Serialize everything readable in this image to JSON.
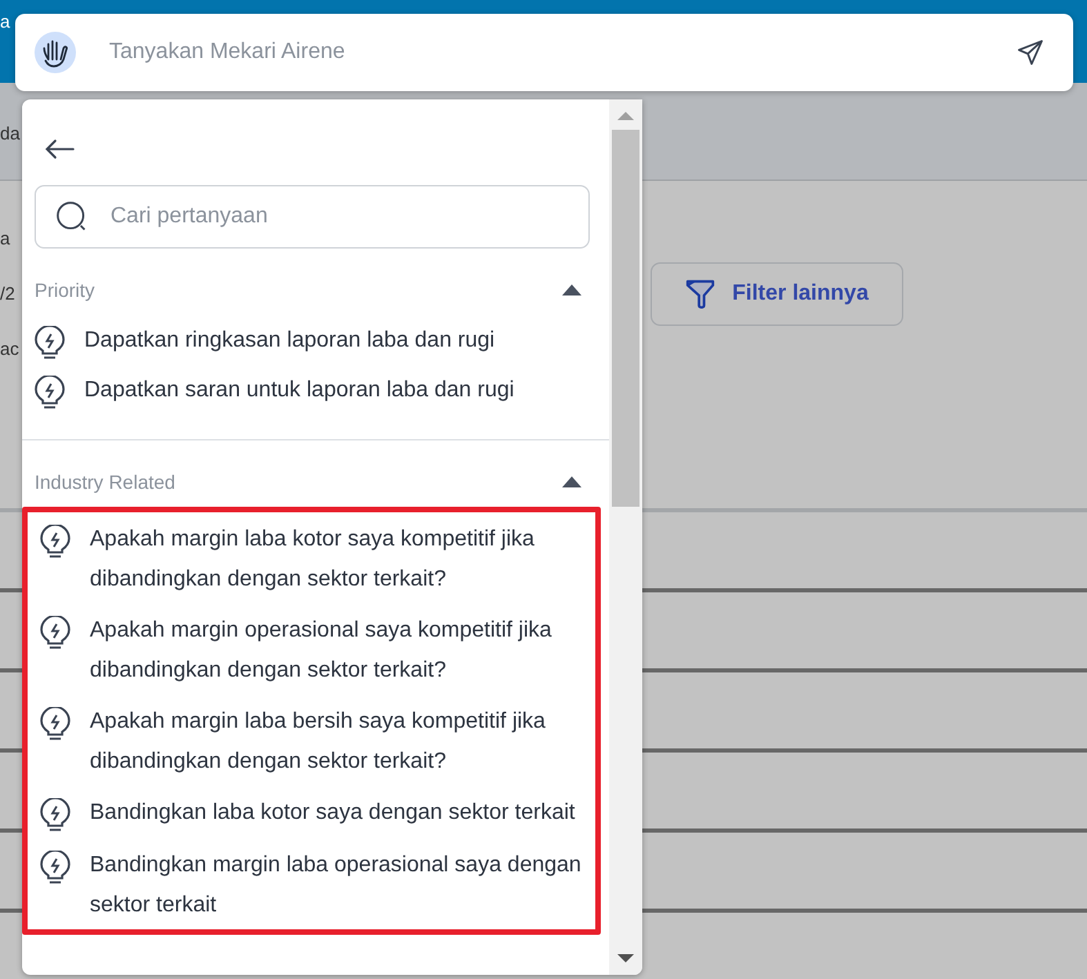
{
  "background": {
    "top_fragment": "a",
    "header_fragment": "da",
    "content_fragments": [
      "a",
      "/2",
      "ac"
    ],
    "filter_button": {
      "label": "Filter lainnya"
    }
  },
  "ask_bar": {
    "placeholder": "Tanyakan Mekari Airene"
  },
  "panel": {
    "search": {
      "placeholder": "Cari pertanyaan"
    },
    "sections": [
      {
        "title": "Priority",
        "expanded": true,
        "highlighted": false,
        "items": [
          "Dapatkan ringkasan laporan laba dan rugi",
          "Dapatkan saran untuk laporan laba dan rugi"
        ]
      },
      {
        "title": "Industry Related",
        "expanded": true,
        "highlighted": true,
        "items": [
          "Apakah margin laba kotor saya kompetitif jika dibandingkan dengan sektor terkait?",
          "Apakah margin operasional saya kompetitif jika dibandingkan dengan sektor terkait?",
          "Apakah margin laba bersih saya kompetitif jika dibandingkan dengan sektor terkait?",
          "Bandingkan laba kotor saya dengan sektor terkait",
          "Bandingkan margin laba operasional saya dengan sektor terkait"
        ]
      }
    ]
  }
}
